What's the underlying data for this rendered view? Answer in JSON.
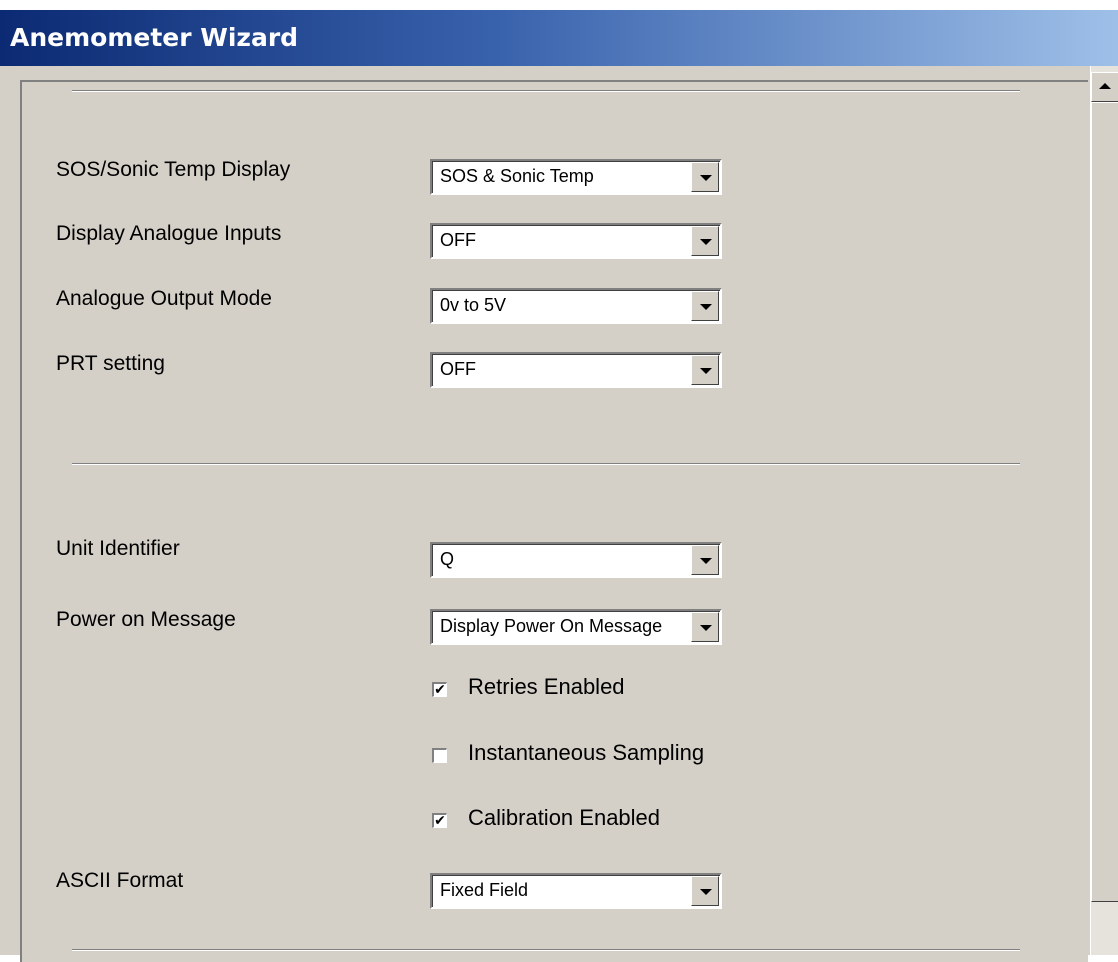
{
  "window": {
    "title": "Anemometer Wizard"
  },
  "settings": {
    "sos_display": {
      "label": "SOS/Sonic Temp Display",
      "value": "SOS & Sonic Temp"
    },
    "analogue_inputs": {
      "label": "Display Analogue Inputs",
      "value": "OFF"
    },
    "analogue_output": {
      "label": "Analogue Output  Mode",
      "value": "0v to 5V"
    },
    "prt": {
      "label": "PRT setting",
      "value": "OFF"
    },
    "unit_identifier": {
      "label": "Unit Identifier",
      "value": "Q"
    },
    "power_on": {
      "label": "Power on Message",
      "value": "Display Power On Message"
    },
    "ascii_format": {
      "label": "ASCII Format",
      "value": "Fixed Field"
    }
  },
  "checkboxes": {
    "retries": {
      "label": "Retries Enabled",
      "checked": true,
      "mark": "✔"
    },
    "instantaneous": {
      "label": "Instantaneous Sampling",
      "checked": false,
      "mark": ""
    },
    "calibration": {
      "label": "Calibration Enabled",
      "checked": true,
      "mark": "✔"
    }
  },
  "colors": {
    "titlebar_start": "#0b2a73",
    "titlebar_end": "#9ec0e8",
    "face": "#d4d0c8"
  }
}
